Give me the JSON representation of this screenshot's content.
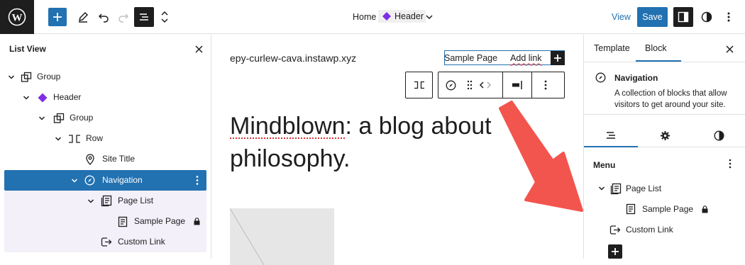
{
  "topbar": {
    "breadcrumb_home": "Home",
    "breadcrumb_template": "Header",
    "view_label": "View",
    "save_label": "Save"
  },
  "list_view": {
    "title": "List View",
    "items": [
      {
        "label": "Group",
        "icon": "group-icon"
      },
      {
        "label": "Header",
        "icon": "template-part-icon"
      },
      {
        "label": "Group",
        "icon": "group-icon"
      },
      {
        "label": "Row",
        "icon": "row-icon"
      },
      {
        "label": "Site Title",
        "icon": "map-marker-icon"
      },
      {
        "label": "Navigation",
        "icon": "compass-icon"
      },
      {
        "label": "Page List",
        "icon": "page-list-icon"
      },
      {
        "label": "Sample Page",
        "icon": "page-icon"
      },
      {
        "label": "Custom Link",
        "icon": "custom-link-icon"
      }
    ]
  },
  "canvas": {
    "site_url": "epy-curlew-cava.instawp.xyz",
    "nav_links": [
      "Sample Page",
      "Add link"
    ],
    "heading_line1_word": "Mindblown",
    "heading_line1_rest": ": a blog about",
    "heading_line2": "philosophy."
  },
  "sidebar": {
    "tabs": [
      "Template",
      "Block"
    ],
    "block_title": "Navigation",
    "block_description": "A collection of blocks that allow visitors to get around your site.",
    "menu_label": "Menu",
    "menu_items": [
      {
        "label": "Page List"
      },
      {
        "label": "Sample Page"
      },
      {
        "label": "Custom Link"
      }
    ]
  },
  "colors": {
    "accent": "#2271b1",
    "dark": "#1e1e1e",
    "arrow": "#f2554d",
    "template_part": "#7f2ee5"
  }
}
